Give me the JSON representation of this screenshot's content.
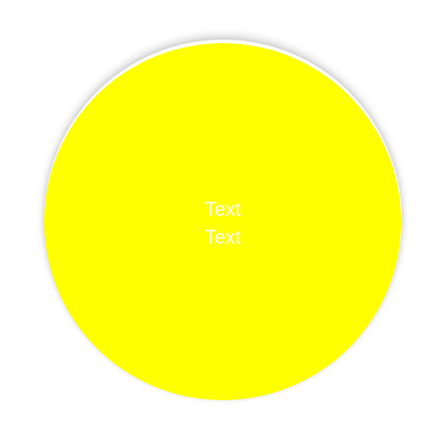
{
  "circle": {
    "color": "#ffff00",
    "text_color": "#ffffff",
    "lines": [
      "Text",
      "Text"
    ]
  }
}
